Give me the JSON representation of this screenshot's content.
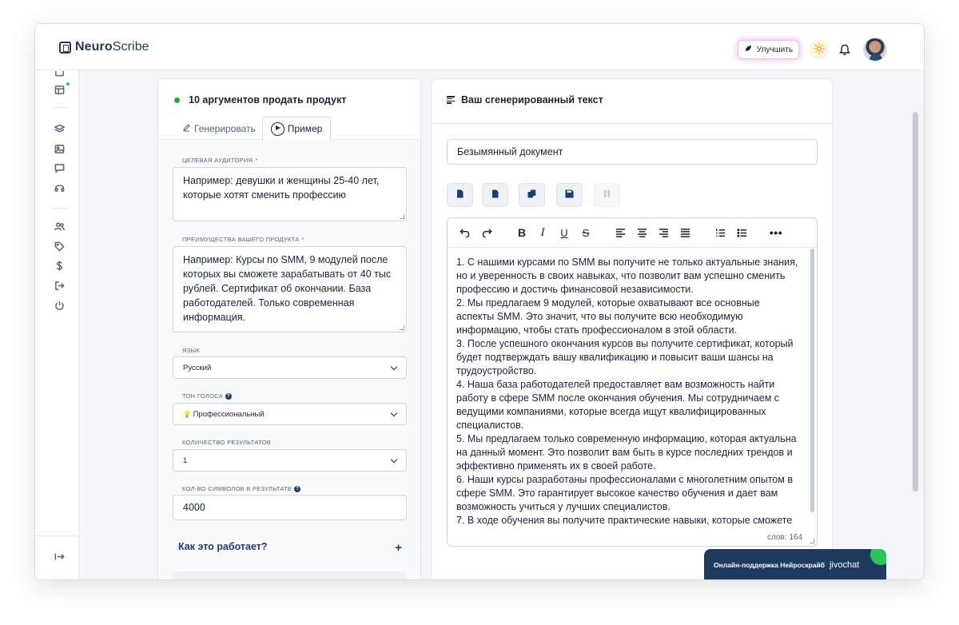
{
  "app": {
    "logo_bold": "Neuro",
    "logo_regular": "Scribe"
  },
  "topbar": {
    "upgrade_label": "Улучшить",
    "rocket_icon": "rocket-icon",
    "theme_icon": "sun-icon",
    "notifications_icon": "bell-icon"
  },
  "sidebar": {
    "items": [
      "document-icon",
      "table-icon",
      "layers-icon",
      "image-icon",
      "chat-icon",
      "headphones-icon",
      "users-icon",
      "tag-icon",
      "dollar-icon",
      "logout-icon",
      "power-icon"
    ],
    "collapse_icon": "collapse-icon"
  },
  "left": {
    "title": "10 аргументов продать продукт",
    "tabs": {
      "generate": "Генерировать",
      "example": "Пример"
    },
    "audience": {
      "label": "Целевая аудитория",
      "required_mark": "*",
      "placeholder": "Например: девушки и женщины 25-40 лет, которые хотят сменить профессию"
    },
    "benefits": {
      "label": "Преимущества вашего продукта",
      "required_mark": "*",
      "placeholder": "Например: Курсы по SMM, 9 модулей после которых вы сможете зарабатывать от 40 тыс рублей. Сертификат об окончании. База работодателей. Только современная информация."
    },
    "language": {
      "label": "Язык",
      "value": "Русский"
    },
    "tone": {
      "label": "Тон голоса",
      "help": "?",
      "emoji": "💡",
      "value": "Профессиональный"
    },
    "results": {
      "label": "Количество результатов",
      "value": "1"
    },
    "chars": {
      "label": "Кол-во символов в результате",
      "help": "?",
      "value": "4000"
    },
    "how_it_works": "Как это работает?",
    "how_plus": "+"
  },
  "right": {
    "title": "Ваш сгенерированный текст",
    "doc_name": "Безымянный документ",
    "actions": [
      "file-doc-icon",
      "file-pdf-icon",
      "copy-icon",
      "save-icon",
      "pause-icon"
    ],
    "toolbar": {
      "bold": "B",
      "italic": "I",
      "underline": "U",
      "strike": "S",
      "more": "•••"
    },
    "paragraphs": [
      "1. С нашими курсами по SMM вы получите не только актуальные знания, но и уверенность в своих навыках, что позволит вам успешно сменить профессию и достичь финансовой независимости.",
      "2. Мы предлагаем 9 модулей, которые охватывают все основные аспекты SMM. Это значит, что вы получите всю необходимую информацию, чтобы стать профессионалом в этой области.",
      "3. После успешного окончания курсов вы получите сертификат, который будет подтверждать вашу квалификацию и повысит ваши шансы на трудоустройство.",
      "4. Наша база работодателей предоставляет вам возможность найти работу в сфере SMM после окончания обучения. Мы сотрудничаем с ведущими компаниями, которые всегда ищут квалифицированных специалистов.",
      "5. Мы предлагаем только современную информацию, которая актуальна на данный момент. Это позволит вам быть в курсе последних трендов и эффективно применять их в своей работе.",
      "6. Наши курсы разработаны профессионалами с многолетним опытом в сфере SMM. Это гарантирует высокое качество обучения и дает вам возможность учиться у лучших специалистов.",
      "7. В ходе обучения вы получите практические навыки, которые сможете"
    ],
    "word_count": "слов: 164"
  },
  "jivo": {
    "label": "Онлайн-поддержка Нейроскрайб",
    "brand": "jivochat"
  }
}
